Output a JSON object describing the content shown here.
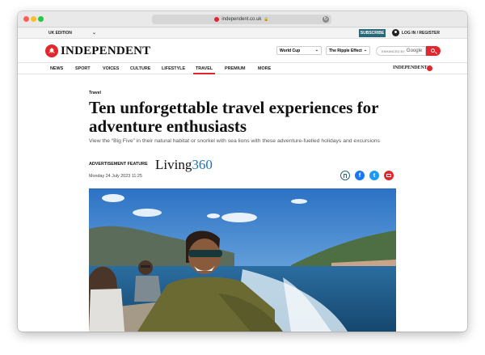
{
  "browser": {
    "url": "independent.co.uk"
  },
  "topbar": {
    "edition": "UK EDITION",
    "subscribe": "SUBSCRIBE",
    "login": "LOG IN / REGISTER"
  },
  "masthead": {
    "logo": "INDEPENDENT",
    "dropdown1": "World Cup",
    "dropdown2": "The Ripple Effect",
    "search_placeholder": "ENHANCED BY",
    "search_brand": "Google"
  },
  "nav": {
    "items": [
      "NEWS",
      "SPORT",
      "VOICES",
      "CULTURE",
      "LIFESTYLE",
      "TRAVEL",
      "PREMIUM",
      "MORE"
    ],
    "active": "TRAVEL",
    "brand": "INDEPENDENT"
  },
  "article": {
    "section": "Travel",
    "headline": "Ten unforgettable travel experiences for adventure enthusiasts",
    "standfirst": "View the “Big Five” in their natural habitat or snorkel with sea lions with these adventure-fuelled holidays and excursions",
    "label": "ADVERTISEMENT FEATURE",
    "sponsor_a": "Living",
    "sponsor_b": "360",
    "date": "Monday 24 July 2023 11:25"
  },
  "colors": {
    "brand_red": "#e3262d",
    "subscribe_teal": "#2a6777",
    "facebook": "#1877f2",
    "twitter": "#1d9bf0"
  }
}
